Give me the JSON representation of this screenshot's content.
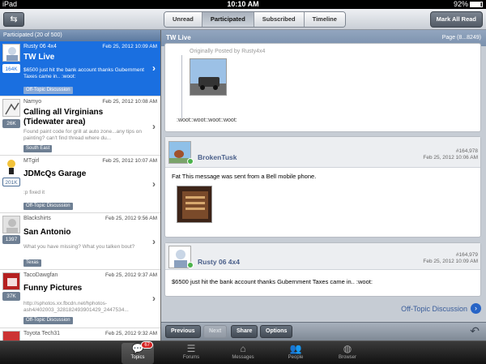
{
  "status": {
    "device": "iPad",
    "time": "10:10 AM",
    "battery": "92%"
  },
  "topbar": {
    "tabs": [
      {
        "label": "Unread",
        "active": false
      },
      {
        "label": "Participated",
        "active": true
      },
      {
        "label": "Subscribed",
        "active": false
      },
      {
        "label": "Timeline",
        "active": false
      }
    ],
    "mark_all_read": "Mark All Read"
  },
  "sidebar": {
    "header": "Participated (20 of 500)",
    "topics": [
      {
        "user": "Rusty 06 4x4",
        "date": "Feb 25, 2012 10:09 AM",
        "title": "TW Live",
        "count": "164K",
        "preview": "$6500 just hit the bank account thanks Gubernment Taxes came in.. :woot:",
        "tag": "Off-Topic Discussion",
        "selected": true
      },
      {
        "user": "Namyo",
        "date": "Feb 25, 2012 10:08 AM",
        "title": "Calling all Virginians (Tidewater area)",
        "count": "26K",
        "preview": "Found paint code for grill at auto zone...any tips on painting? can't find thread where du...",
        "tag": "South East",
        "selected": false
      },
      {
        "user": "MTgirl",
        "date": "Feb 25, 2012 10:07 AM",
        "title": "JDMcQs Garage",
        "count": "201K",
        "preview": ":p fixed it",
        "tag": "Off-Topic Discussion",
        "selected": false
      },
      {
        "user": "Blackshirts",
        "date": "Feb 25, 2012 9:56 AM",
        "title": "San Antonio",
        "count": "1397",
        "preview": "What you have missing? What you talken bout?",
        "tag": "Texas",
        "selected": false
      },
      {
        "user": "TacoDawgfan",
        "date": "Feb 25, 2012 9:37 AM",
        "title": "Funny Pictures",
        "count": "37K",
        "preview": "http://sphotos.xx.fbcdn.net/hphotos-ash4/402003_328182493901429_2447534...",
        "tag": "Off-Topic Discussion",
        "selected": false
      },
      {
        "user": "Toyota Tech31",
        "date": "Feb 25, 2012 9:32 AM",
        "title": "",
        "count": "",
        "preview": "",
        "tag": "",
        "selected": false
      }
    ]
  },
  "thread": {
    "title": "TW Live",
    "page": "Page (8...8249)",
    "quote_label": "Originally Posted by Rusty4x4",
    "smileys": ":woot::woot::woot::woot:",
    "posts": [
      {
        "author": "BrokenTusk",
        "num": "#164,978",
        "date": "Feb 25, 2012 10:06 AM",
        "body": "Fat This message was sent from a Bell mobile phone."
      },
      {
        "author": "Rusty 06 4x4",
        "num": "#164,979",
        "date": "Feb 25, 2012 10:09 AM",
        "body": "$6500 just hit the bank account thanks Gubernment Taxes came in.. :woot:"
      }
    ],
    "forum_link": "Off-Topic Discussion"
  },
  "toolbar": {
    "previous": "Previous",
    "next": "Next",
    "share": "Share",
    "options": "Options"
  },
  "tabbar": {
    "tabs": [
      {
        "label": "Topics",
        "icon": "speech-bubbles-icon",
        "badge": "67",
        "active": true
      },
      {
        "label": "Forums",
        "icon": "list-icon",
        "active": false
      },
      {
        "label": "Messages",
        "icon": "inbox-icon",
        "active": false
      },
      {
        "label": "People",
        "icon": "people-icon",
        "active": false
      },
      {
        "label": "Browser",
        "icon": "globe-icon",
        "active": false
      }
    ]
  },
  "colors": {
    "selection_blue": "#1a6fe0",
    "badge_red": "#d42222",
    "link_blue": "#3a5d9a"
  }
}
